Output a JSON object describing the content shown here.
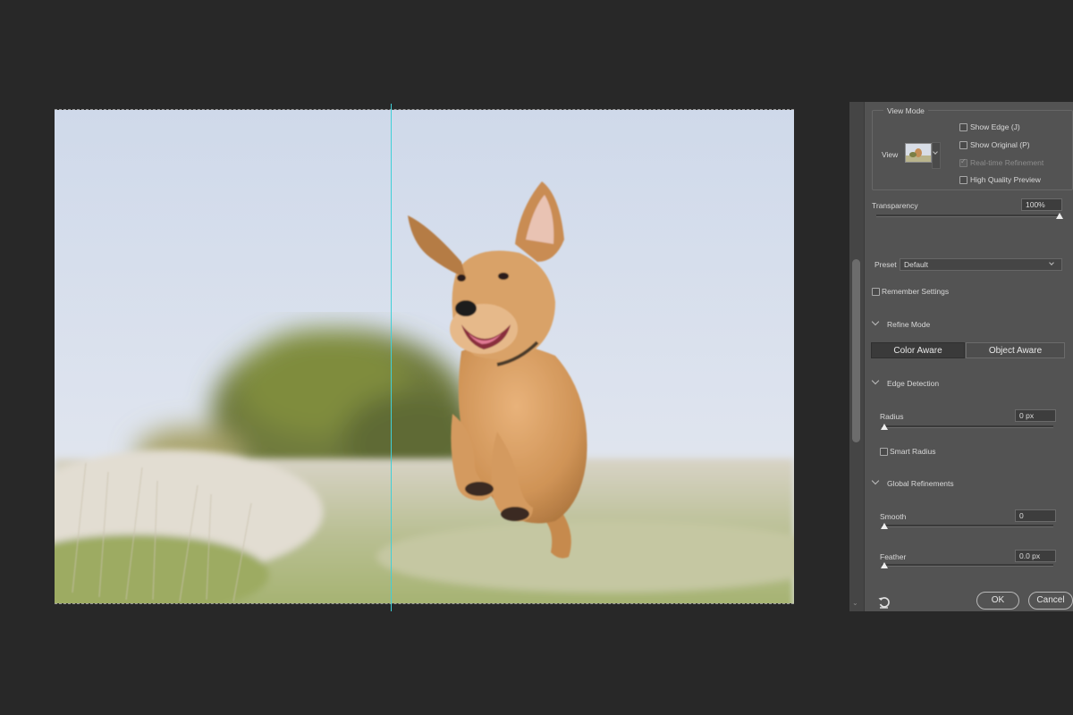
{
  "view_mode": {
    "legend": "View Mode",
    "view_label": "View",
    "options": [
      {
        "label": "Show Edge (J)",
        "checked": false,
        "enabled": true
      },
      {
        "label": "Show Original (P)",
        "checked": false,
        "enabled": true
      },
      {
        "label": "Real-time Refinement",
        "checked": true,
        "enabled": false
      },
      {
        "label": "High Quality Preview",
        "checked": false,
        "enabled": true
      }
    ]
  },
  "transparency": {
    "label": "Transparency",
    "value": "100%",
    "level": 1.0
  },
  "preset": {
    "label": "Preset",
    "value": "Default"
  },
  "remember_settings": {
    "label": "Remember Settings",
    "checked": false
  },
  "refine_mode": {
    "title": "Refine Mode",
    "options": [
      "Color Aware",
      "Object Aware"
    ],
    "selected": "Color Aware"
  },
  "edge_detection": {
    "title": "Edge Detection",
    "radius": {
      "label": "Radius",
      "value": "0 px",
      "level": 0
    },
    "smart_radius": {
      "label": "Smart Radius",
      "checked": false
    }
  },
  "global_refinements": {
    "title": "Global Refinements",
    "smooth": {
      "label": "Smooth",
      "value": "0",
      "level": 0
    },
    "feather": {
      "label": "Feather",
      "value": "0.0 px",
      "level": 0
    }
  },
  "buttons": {
    "ok": "OK",
    "cancel": "Cancel"
  },
  "icons": {
    "reset": "reset-icon",
    "section_toggle": "chevron-down-icon",
    "scroll_down": "scroll-down-arrow-icon"
  },
  "colors": {
    "app_bg": "#282828",
    "panel_bg": "#535353",
    "split_guide": "#3fd0d8"
  }
}
